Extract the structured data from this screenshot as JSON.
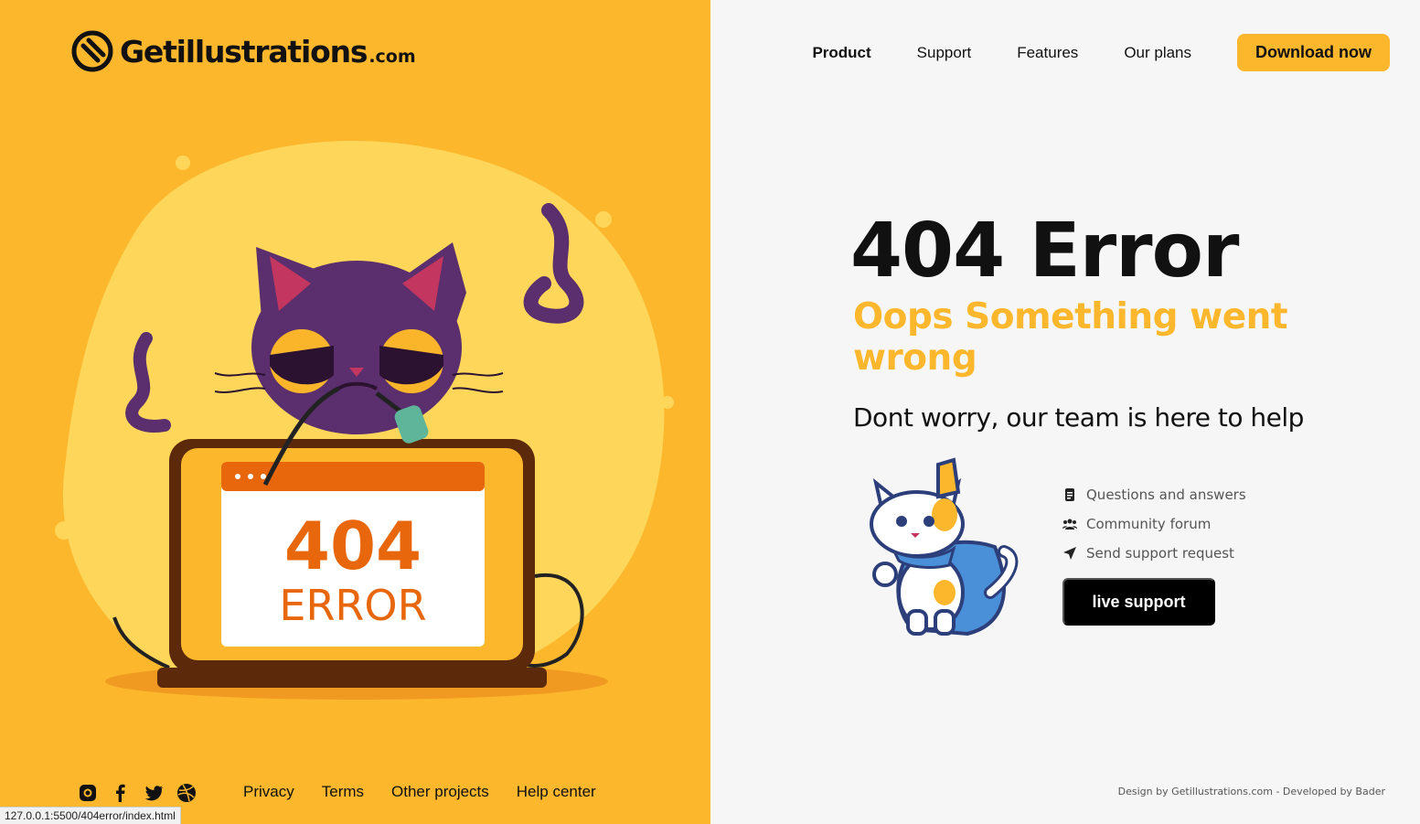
{
  "logo": {
    "name": "Getillustrations",
    "suffix": ".com"
  },
  "nav": {
    "items": [
      "Product",
      "Support",
      "Features",
      "Our plans"
    ],
    "cta": "Download now"
  },
  "illustration": {
    "screen_number": "404",
    "screen_word": "ERROR"
  },
  "hero": {
    "title": "404 Error",
    "subtitle": "Oops Something went wrong",
    "help": "Dont worry, our team is here to help"
  },
  "support": {
    "links": [
      {
        "icon": "document-icon",
        "label": "Questions and answers"
      },
      {
        "icon": "users-icon",
        "label": "Community forum"
      },
      {
        "icon": "send-icon",
        "label": "Send support request"
      }
    ],
    "button": "live support"
  },
  "footer": {
    "social": [
      "instagram-icon",
      "facebook-icon",
      "twitter-icon",
      "dribbble-icon"
    ],
    "links": [
      "Privacy",
      "Terms",
      "Other projects",
      "Help center"
    ],
    "credit": "Design by Getillustrations.com - Developed by Bader"
  },
  "status_bar": {
    "url": "127.0.0.1:5500/404error/index.html"
  },
  "colors": {
    "accent": "#fcb72d",
    "orange": "#e8670d",
    "purple": "#5b2f6e",
    "text": "#111111"
  }
}
